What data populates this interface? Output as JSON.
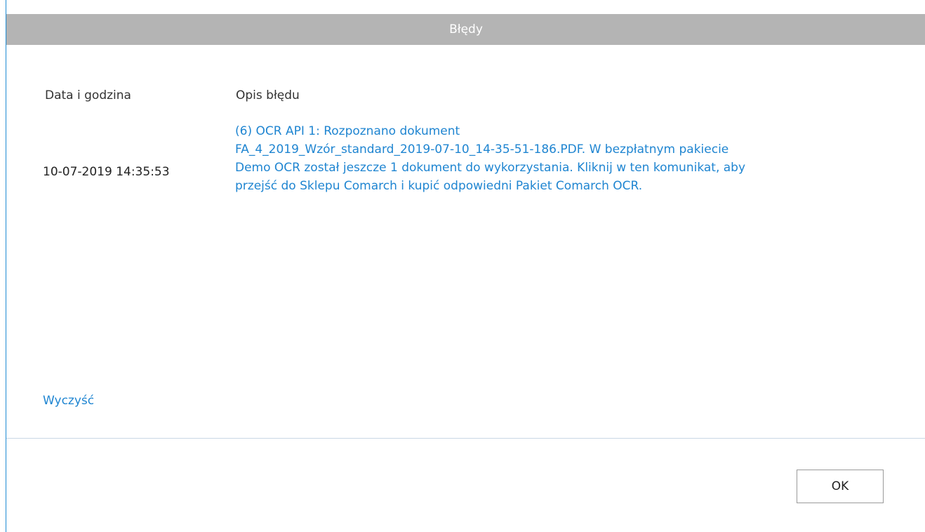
{
  "window": {
    "title": "Błędy"
  },
  "table": {
    "columns": [
      "Data i godzina",
      "Opis błędu"
    ],
    "rows": [
      {
        "datetime": "10-07-2019 14:35:53",
        "description_lines": [
          "(6) OCR API 1: Rozpoznano dokument",
          "FA_4_2019_Wzór_standard_2019-07-10_14-35-51-186.PDF. W bezpłatnym pakiecie",
          "Demo OCR został jeszcze 1 dokument do wykorzystania. Kliknij w ten komunikat, aby",
          "przejść do Sklepu Comarch i kupić odpowiedni Pakiet Comarch OCR."
        ]
      }
    ]
  },
  "actions": {
    "clear_label": "Wyczyść",
    "ok_label": "OK"
  },
  "colors": {
    "titlebar": "#b4b4b4",
    "link": "#1f85d1",
    "border_accent": "#1f8bd3"
  }
}
